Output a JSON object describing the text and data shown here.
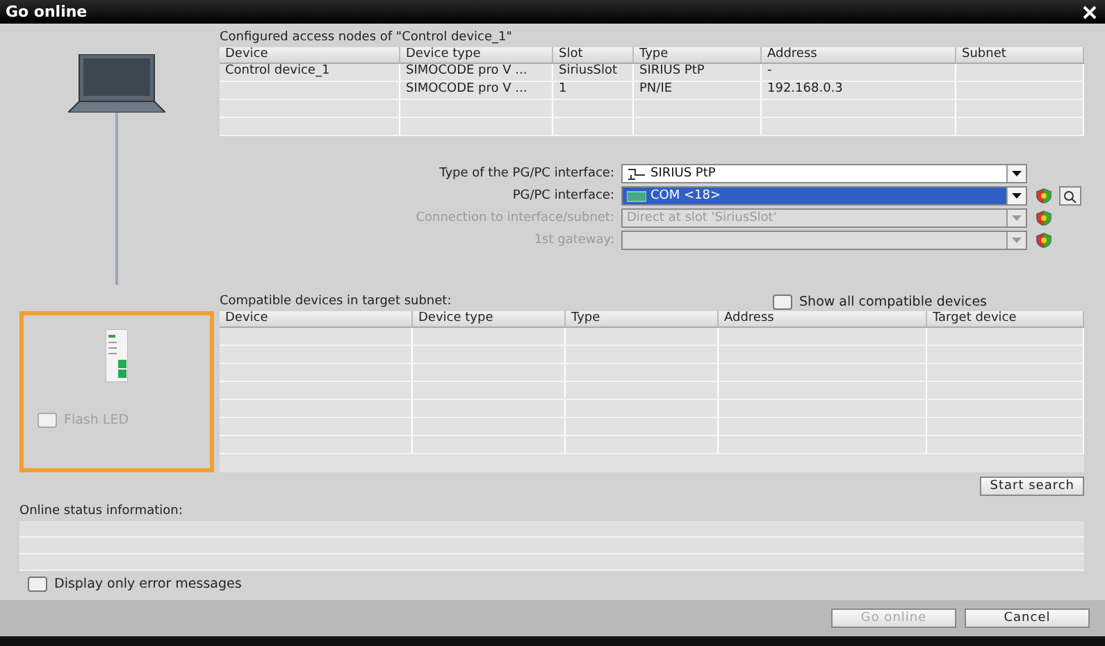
{
  "window": {
    "title": "Go online"
  },
  "configured": {
    "title": "Configured access nodes of \"Control device_1\"",
    "columns": [
      "Device",
      "Device type",
      "Slot",
      "Type",
      "Address",
      "Subnet"
    ],
    "rows": [
      [
        "Control device_1",
        "SIMOCODE pro V ...",
        "SiriusSlot",
        "SIRIUS PtP",
        "-",
        ""
      ],
      [
        "",
        "SIMOCODE pro V ...",
        "1",
        "PN/IE",
        "192.168.0.3",
        ""
      ]
    ]
  },
  "interface_fields": [
    {
      "label": "Type of the PG/PC interface:",
      "value": "SIRIUS PtP",
      "selected": false,
      "disabled": false,
      "status_icon": false,
      "search_icon": false
    },
    {
      "label": "PG/PC interface:",
      "value": "COM <18>",
      "selected": true,
      "disabled": false,
      "status_icon": true,
      "search_icon": true
    },
    {
      "label": "Connection to interface/subnet:",
      "value": "Direct at slot 'SiriusSlot'",
      "selected": false,
      "disabled": true,
      "status_icon": true,
      "search_icon": false
    },
    {
      "label": "1st gateway:",
      "selected": false,
      "disabled": true,
      "status_icon": true,
      "search_icon": false
    }
  ],
  "compatible": {
    "title": "Compatible devices in target subnet:",
    "show_all": {
      "label": "Show all compatible devices",
      "checked": false
    },
    "columns": [
      "Device",
      "Device type",
      "Type",
      "Address",
      "Target device"
    ]
  },
  "flash_led": {
    "label": "Flash LED",
    "checked": false,
    "disabled": true
  },
  "start_search": "Start search",
  "status": {
    "title": "Online status information:",
    "error_only": {
      "label": "Display only error messages",
      "checked": false
    }
  },
  "buttons": [
    {
      "label": "Go online",
      "disabled": true
    },
    {
      "label": "Cancel",
      "disabled": false
    }
  ]
}
